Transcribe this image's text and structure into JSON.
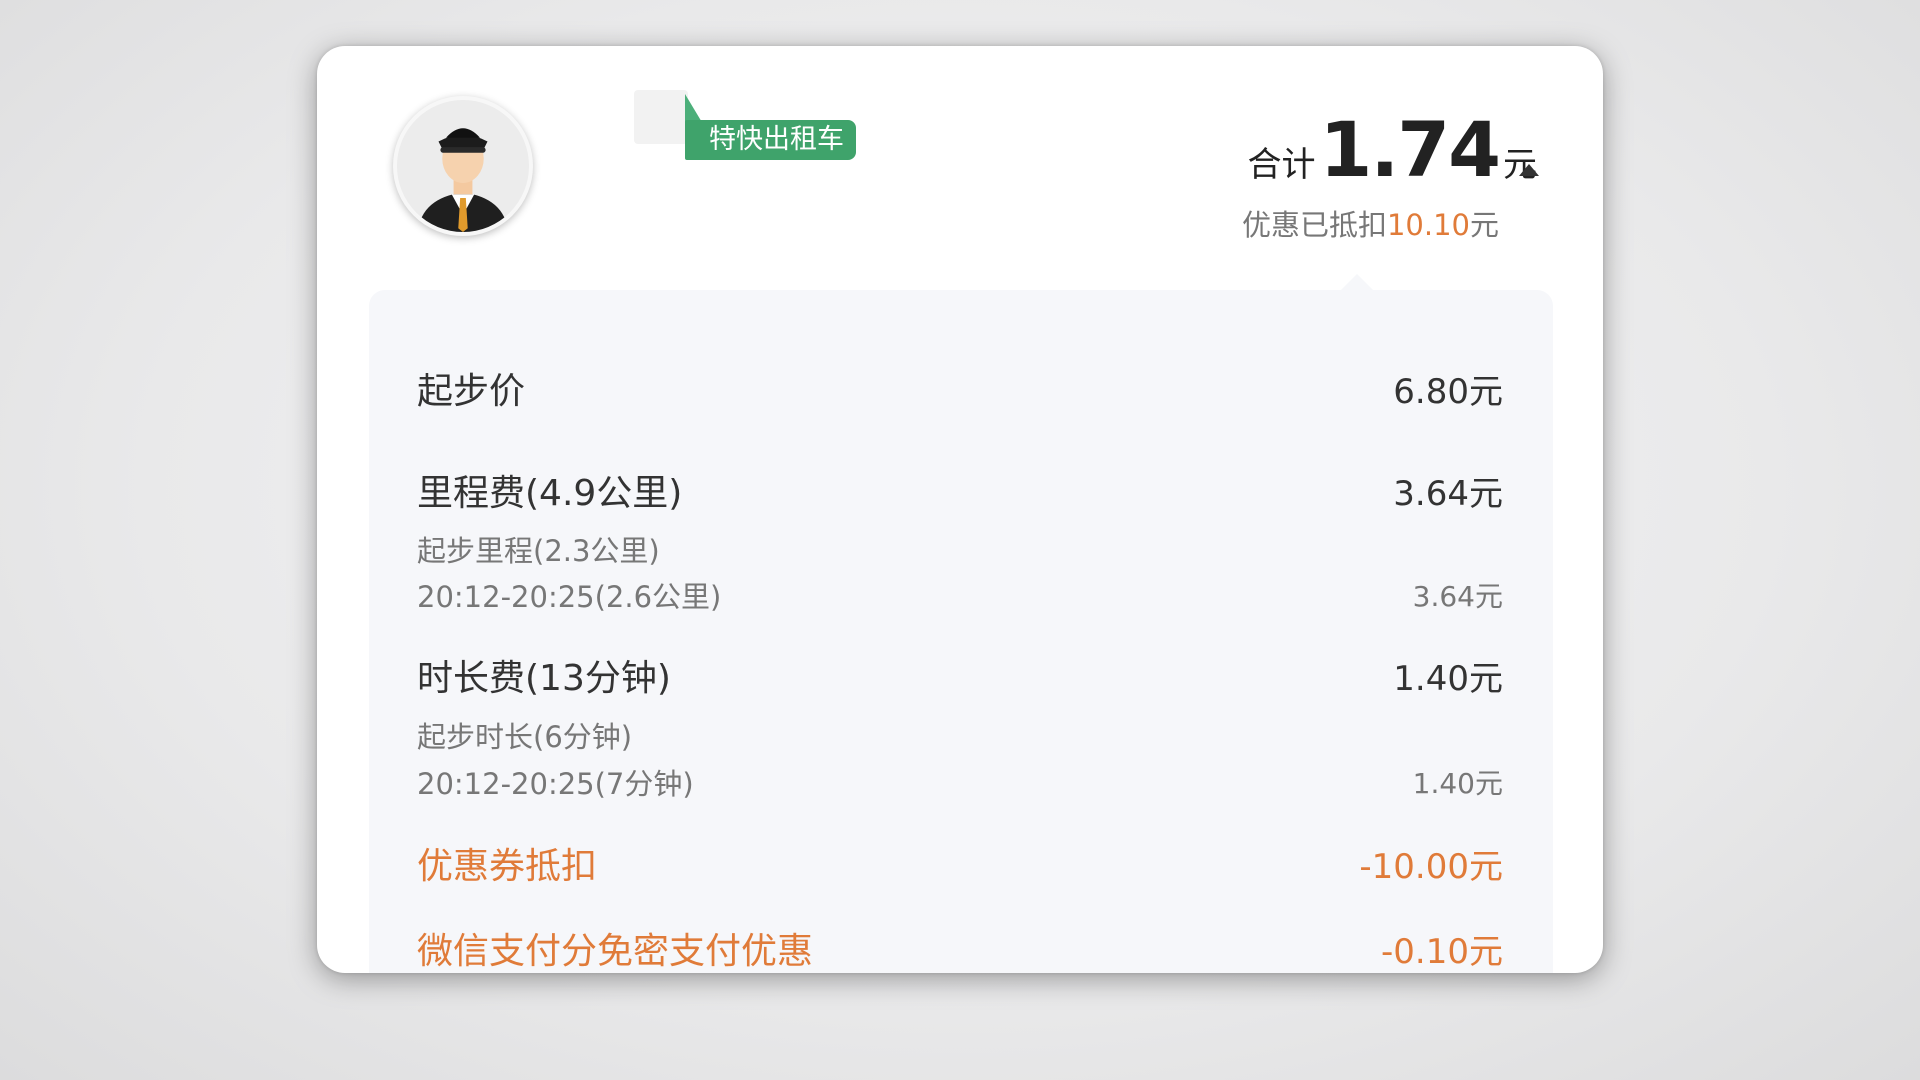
{
  "service_tag": "特快出租车",
  "summary": {
    "total_prefix": "合计",
    "total_amount": "1.74",
    "total_unit": "元",
    "discount_prefix": "优惠已抵扣",
    "discount_amount": "10.10",
    "discount_unit": "元"
  },
  "fees": {
    "base": {
      "label": "起步价",
      "value": "6.80元"
    },
    "distance": {
      "label": "里程费(4.9公里)",
      "value": "3.64元",
      "sub1_label": "起步里程(2.3公里)",
      "sub2_label": "20:12-20:25(2.6公里)",
      "sub2_value": "3.64元"
    },
    "duration": {
      "label": "时长费(13分钟)",
      "value": "1.40元",
      "sub1_label": "起步时长(6分钟)",
      "sub2_label": "20:12-20:25(7分钟)",
      "sub2_value": "1.40元"
    },
    "coupon": {
      "label": "优惠券抵扣",
      "value": "-10.00元"
    },
    "wechat": {
      "label": "微信支付分免密支付优惠",
      "value": "-0.10元"
    }
  },
  "icons": {
    "avatar": "driver-avatar-icon",
    "caret": "caret-up-icon"
  },
  "colors": {
    "tag_green": "#3fa36b",
    "discount_orange": "#e07b39",
    "panel_bg": "#f6f7fa"
  }
}
